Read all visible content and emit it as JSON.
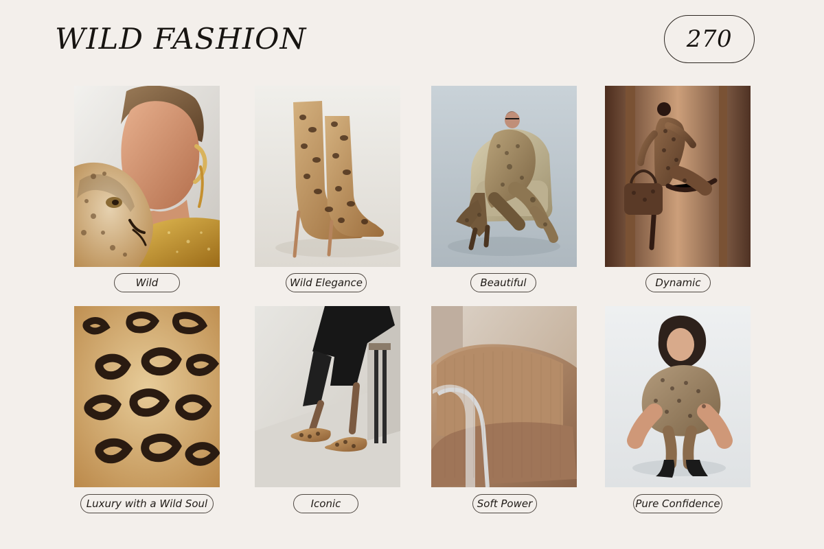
{
  "page": {
    "title": "WILD FASHION",
    "number": "270"
  },
  "gallery": {
    "items": [
      {
        "caption": "Wild"
      },
      {
        "caption": "Wild Elegance"
      },
      {
        "caption": "Beautiful"
      },
      {
        "caption": "Dynamic"
      },
      {
        "caption": "Luxury with a Wild Soul"
      },
      {
        "caption": "Iconic"
      },
      {
        "caption": "Soft Power"
      },
      {
        "caption": "Pure Confidence"
      }
    ]
  }
}
